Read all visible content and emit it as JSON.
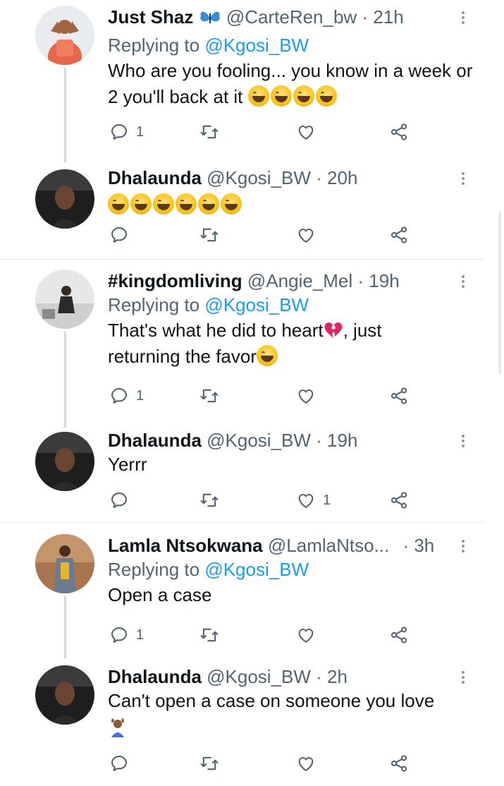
{
  "icons": {
    "reply": "reply-bubble-icon",
    "retweet": "retweet-icon",
    "like": "heart-icon",
    "share": "share-icon",
    "more": "more-vertical-icon"
  },
  "colors": {
    "text": "#0f1419",
    "muted": "#536471",
    "link": "#1d9bf0",
    "divider": "#e6ecf0"
  },
  "tweets": [
    {
      "name": "Just Shaz",
      "name_emoji": "butterfly",
      "handle": "@CarteRen_bw",
      "time": "· 21h",
      "replying_prefix": "Replying to",
      "replying_to": "@Kgosi_BW",
      "text": "Who are you fooling... you know in a week or 2 you'll back at it",
      "emojis": "rolling-laughing x2, grinning-sweat x2",
      "reply_count": "1",
      "like_count": ""
    },
    {
      "name": "Dhalaunda",
      "handle": "@Kgosi_BW",
      "time": "· 20h",
      "text": "",
      "emojis": "grinning-sweat x6",
      "reply_count": "",
      "like_count": ""
    },
    {
      "name": "#kingdomliving",
      "handle": "@Angie_Mel",
      "time": "· 19h",
      "replying_prefix": "Replying to",
      "replying_to": "@Kgosi_BW",
      "text_1": "That's what he did to heart",
      "text_2": ", just",
      "text_3": "returning the favor",
      "emojis": "broken-heart, winking-tongue",
      "reply_count": "1",
      "like_count": ""
    },
    {
      "name": "Dhalaunda",
      "handle": "@Kgosi_BW",
      "time": "· 19h",
      "text": "Yerrr",
      "reply_count": "",
      "like_count": "1"
    },
    {
      "name": "Lamla Ntsokwana",
      "handle": "@LamlaNtso...",
      "time": "· 3h",
      "replying_prefix": "Replying to",
      "replying_to": "@Kgosi_BW",
      "text": "Open a case",
      "reply_count": "1",
      "like_count": ""
    },
    {
      "name": "Dhalaunda",
      "handle": "@Kgosi_BW",
      "time": "· 2h",
      "text": "Can't open a case on someone you love",
      "emojis": "person-gesturing-ok",
      "reply_count": "",
      "like_count": ""
    }
  ]
}
